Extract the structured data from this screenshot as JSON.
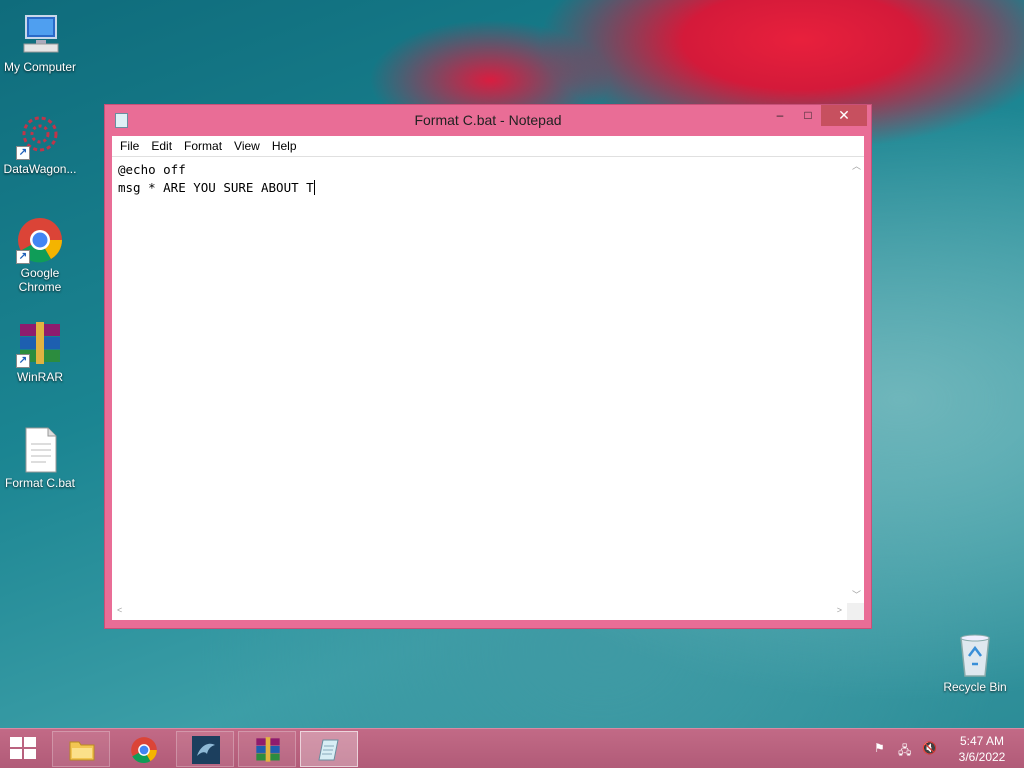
{
  "desktop": {
    "icons": [
      {
        "label": "My Computer"
      },
      {
        "label": "DataWagon..."
      },
      {
        "label": "Google Chrome"
      },
      {
        "label": "WinRAR"
      },
      {
        "label": "Format C.bat"
      },
      {
        "label": "Recycle Bin"
      }
    ]
  },
  "window": {
    "title": "Format C.bat - Notepad",
    "minimize": "–",
    "maximize": "□",
    "close": "✕"
  },
  "menu": {
    "file": "File",
    "edit": "Edit",
    "format": "Format",
    "view": "View",
    "help": "Help"
  },
  "editor": {
    "line1": "@echo off",
    "line2": "msg * ARE YOU SURE ABOUT T"
  },
  "taskbar": {
    "time": "5:47 AM",
    "date": "3/6/2022"
  },
  "colors": {
    "accent": "#e96d96",
    "close": "#c7505f",
    "taskbar": "#b95f7d"
  }
}
